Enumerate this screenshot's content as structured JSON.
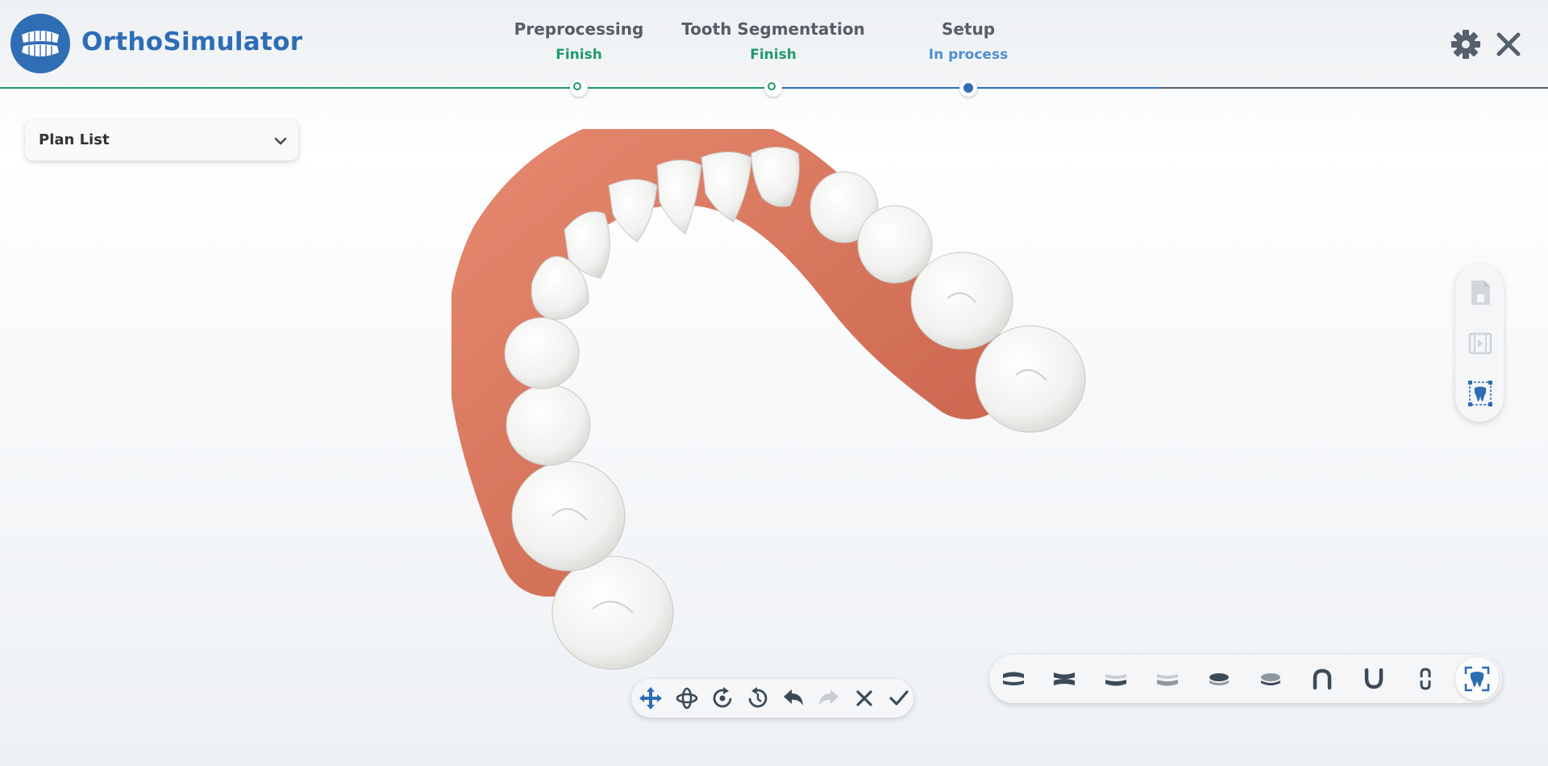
{
  "app": {
    "title": "OrthoSimulator",
    "logo_icon": "teeth-logo-icon"
  },
  "progress": {
    "steps": [
      {
        "name": "Preprocessing",
        "status": "Finish",
        "state": "done"
      },
      {
        "name": "Tooth Segmentation",
        "status": "Finish",
        "state": "done"
      },
      {
        "name": "Setup",
        "status": "In process",
        "state": "active"
      }
    ],
    "colors": {
      "done": "#1f9a6a",
      "active": "#2f6db5"
    }
  },
  "header_actions": [
    {
      "icon": "gear-icon"
    },
    {
      "icon": "close-icon"
    }
  ],
  "plan_list": {
    "label": "Plan List",
    "icon": "chevron-down-icon"
  },
  "side_panel": {
    "buttons": [
      {
        "icon": "save-file-icon",
        "enabled": false
      },
      {
        "icon": "video-icon",
        "enabled": false
      },
      {
        "icon": "tooth-select-icon",
        "enabled": true
      }
    ]
  },
  "nav_toolbar": {
    "buttons": [
      {
        "icon": "move-icon"
      },
      {
        "icon": "pan-icon"
      },
      {
        "icon": "rotate-icon"
      },
      {
        "icon": "history-icon"
      },
      {
        "icon": "undo-icon"
      },
      {
        "icon": "redo-icon",
        "enabled": false
      },
      {
        "icon": "cancel-icon"
      },
      {
        "icon": "confirm-icon"
      }
    ]
  },
  "view_toolbar": {
    "buttons": [
      {
        "icon": "upper-jaw-icon"
      },
      {
        "icon": "both-jaws-icon"
      },
      {
        "icon": "lower-jaw-icon"
      },
      {
        "icon": "lower-jaw-faded-icon"
      },
      {
        "icon": "left-view-icon"
      },
      {
        "icon": "right-view-icon"
      },
      {
        "icon": "maxillary-view-icon"
      },
      {
        "icon": "mandibular-view-icon"
      },
      {
        "icon": "front-view-icon"
      },
      {
        "icon": "reset-view-icon"
      }
    ]
  },
  "viewport": {
    "model": "upper-dental-arch",
    "colors": {
      "gum": "#d9775f",
      "tooth": "#f6f6f4"
    }
  }
}
